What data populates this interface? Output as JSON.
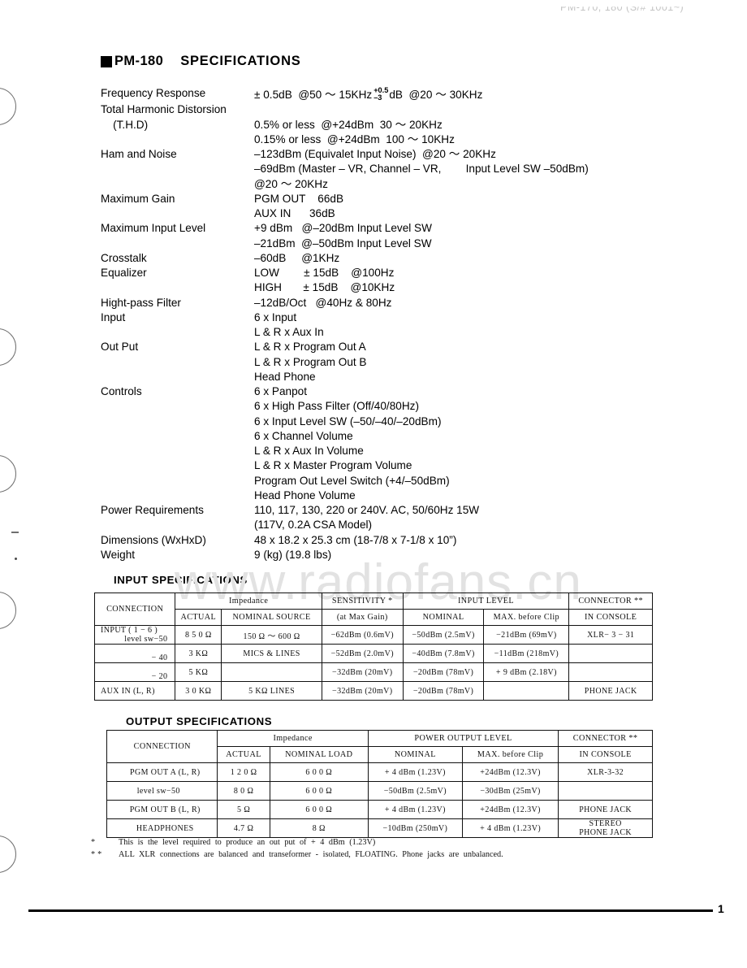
{
  "scan_header": "PM-170, 180 (S/# 1001~)",
  "watermark": "www.radiofans.cn",
  "page_number": "1",
  "title": {
    "model": "PM-180",
    "word": "SPECIFICATIONS"
  },
  "specs": [
    {
      "label": "Frequency Response",
      "values": [
        "± 0.5dB  @50 ～ 15KHz"
      ],
      "has_fraction": true,
      "fraction_top": "+0.5",
      "fraction_bottom": "–3",
      "fraction_tail": "dB  @20 ～ 30KHz"
    },
    {
      "label": "Total Harmonic Distorsion\n    (T.H.D)",
      "values": [
        "",
        "0.5% or less  @+24dBm  30 ～ 20KHz",
        "0.15% or less  @+24dBm  100 ～ 10KHz"
      ]
    },
    {
      "label": "Ham and Noise",
      "values": [
        "–123dBm (Equivalet Input Noise)  @20 ～ 20KHz",
        "–69dBm (Master – VR, Channel – VR,        Input Level SW –50dBm)",
        "@20 ～ 20KHz"
      ]
    },
    {
      "label": "Maximum Gain",
      "values": [
        "PGM OUT    66dB",
        "AUX IN      36dB"
      ]
    },
    {
      "label": "Maximum Input Level",
      "values": [
        "+9 dBm   @–20dBm Input Level SW",
        "–21dBm  @–50dBm Input Level SW"
      ]
    },
    {
      "label": "Crosstalk",
      "values": [
        "–60dB     @1KHz"
      ]
    },
    {
      "label": "Equalizer",
      "values": [
        "LOW        ± 15dB    @100Hz",
        "HIGH       ± 15dB    @10KHz"
      ]
    },
    {
      "label": "Hight-pass Filter",
      "values": [
        "–12dB/Oct   @40Hz & 80Hz"
      ]
    },
    {
      "label": "Input",
      "values": [
        "6 x Input",
        "L & R x Aux In"
      ]
    },
    {
      "label": "Out Put",
      "values": [
        "L & R x Program Out A",
        "L & R x Program Out B",
        "Head Phone"
      ]
    },
    {
      "label": "Controls",
      "values": [
        "6 x Panpot",
        "6 x High Pass Filter (Off/40/80Hz)",
        "6 x Input Level SW (–50/–40/–20dBm)",
        "6 x Channel Volume",
        "L & R x Aux In Volume",
        "L & R x Master Program Volume",
        "Program Out Level Switch (+4/–50dBm)",
        "Head Phone Volume"
      ]
    },
    {
      "label": "Power Requirements",
      "values": [
        "110, 117, 130, 220 or 240V. AC, 50/60Hz 15W",
        "(117V, 0.2A CSA Model)"
      ]
    },
    {
      "label": "Dimensions (WxHxD)",
      "values": [
        "48 x 18.2 x 25.3 cm (18-7/8 x 7-1/8 x 10”)"
      ]
    },
    {
      "label": "Weight",
      "values": [
        "9 (kg) (19.8 lbs)"
      ]
    }
  ],
  "input_table": {
    "caption": "INPUT    SPECIFICATIONS",
    "headers": {
      "connection": "CONNECTION",
      "impedance": "Impedance",
      "actual": "ACTUAL",
      "nominal_source": "NOMINAL  SOURCE",
      "sensitivity": "SENSITIVITY *",
      "sensitivity_sub": "(at  Max  Gain)",
      "input_level": "INPUT      LEVEL",
      "nominal": "NOMINAL",
      "max_before_clip": "MAX. before Clip",
      "connector": "CONNECTOR **",
      "connector_sub": "IN  CONSOLE"
    },
    "rows": [
      {
        "connection": "INPUT ( 1 − 6 )",
        "connection2": "level sw−50",
        "actual": "8 5 0 Ω",
        "nominal_source": "150 Ω ～ 600 Ω",
        "sensitivity": "−62dBm  (0.6mV)",
        "nominal": "−50dBm  (2.5mV)",
        "max_clip": "−21dBm  (69mV)",
        "connector": "XLR− 3 − 31"
      },
      {
        "connection": "",
        "connection2": "− 40",
        "actual": "3 KΩ",
        "nominal_source": "MICS  &  LINES",
        "sensitivity": "−52dBm  (2.0mV)",
        "nominal": "−40dBm  (7.8mV)",
        "max_clip": "−11dBm  (218mV)",
        "connector": ""
      },
      {
        "connection": "",
        "connection2": "− 20",
        "actual": "5 KΩ",
        "nominal_source": "",
        "sensitivity": "−32dBm  (20mV)",
        "nominal": "−20dBm  (78mV)",
        "max_clip": "+ 9 dBm  (2.18V)",
        "connector": ""
      },
      {
        "connection": "AUX IN (L, R)",
        "connection2": "",
        "actual": "3 0 KΩ",
        "nominal_source": "5 KΩ    LINES",
        "sensitivity": "−32dBm  (20mV)",
        "nominal": "−20dBm  (78mV)",
        "max_clip": "",
        "connector": "PHONE JACK"
      }
    ]
  },
  "output_table": {
    "caption": "OUTPUT    SPECIFICATIONS",
    "headers": {
      "connection": "CONNECTION",
      "impedance": "Impedance",
      "actual": "ACTUAL",
      "nominal_load": "NOMINAL    LOAD",
      "power_output_level": "POWER    OUTPUT    LEVEL",
      "nominal": "NOMINAL",
      "max_before_clip": "MAX. before Clip",
      "connector": "CONNECTOR **",
      "connector_sub": "IN  CONSOLE"
    },
    "rows": [
      {
        "connection": "PGM OUT A (L, R)",
        "actual": "1 2 0 Ω",
        "nominal_load": "6 0 0 Ω",
        "nominal": "+ 4 dBm  (1.23V)",
        "max_clip": "+24dBm  (12.3V)",
        "connector": "XLR-3-32"
      },
      {
        "connection": "level sw−50",
        "actual": "8 0 Ω",
        "nominal_load": "6 0 0 Ω",
        "nominal": "−50dBm  (2.5mV)",
        "max_clip": "−30dBm  (25mV)",
        "connector": ""
      },
      {
        "connection": "PGM OUT B (L, R)",
        "actual": "5 Ω",
        "nominal_load": "6 0 0 Ω",
        "nominal": "+ 4 dBm  (1.23V)",
        "max_clip": "+24dBm  (12.3V)",
        "connector": "PHONE JACK"
      },
      {
        "connection": "HEADPHONES",
        "actual": "4.7 Ω",
        "nominal_load": "8 Ω",
        "nominal": "−10dBm  (250mV)",
        "max_clip": "+ 4 dBm  (1.23V)",
        "connector": "STEREO\n  PHONE JACK"
      }
    ]
  },
  "footnotes": [
    {
      "mark": "*",
      "text": "This  is  the  level  required  to  produce  an  out  put  of  + 4 dBm  (1.23V)"
    },
    {
      "mark": "**",
      "text": "ALL  XLR  connections  are  balanced  and  transeformer - isolated,  FLOATING.  Phone  jacks  are  unbalanced."
    }
  ]
}
